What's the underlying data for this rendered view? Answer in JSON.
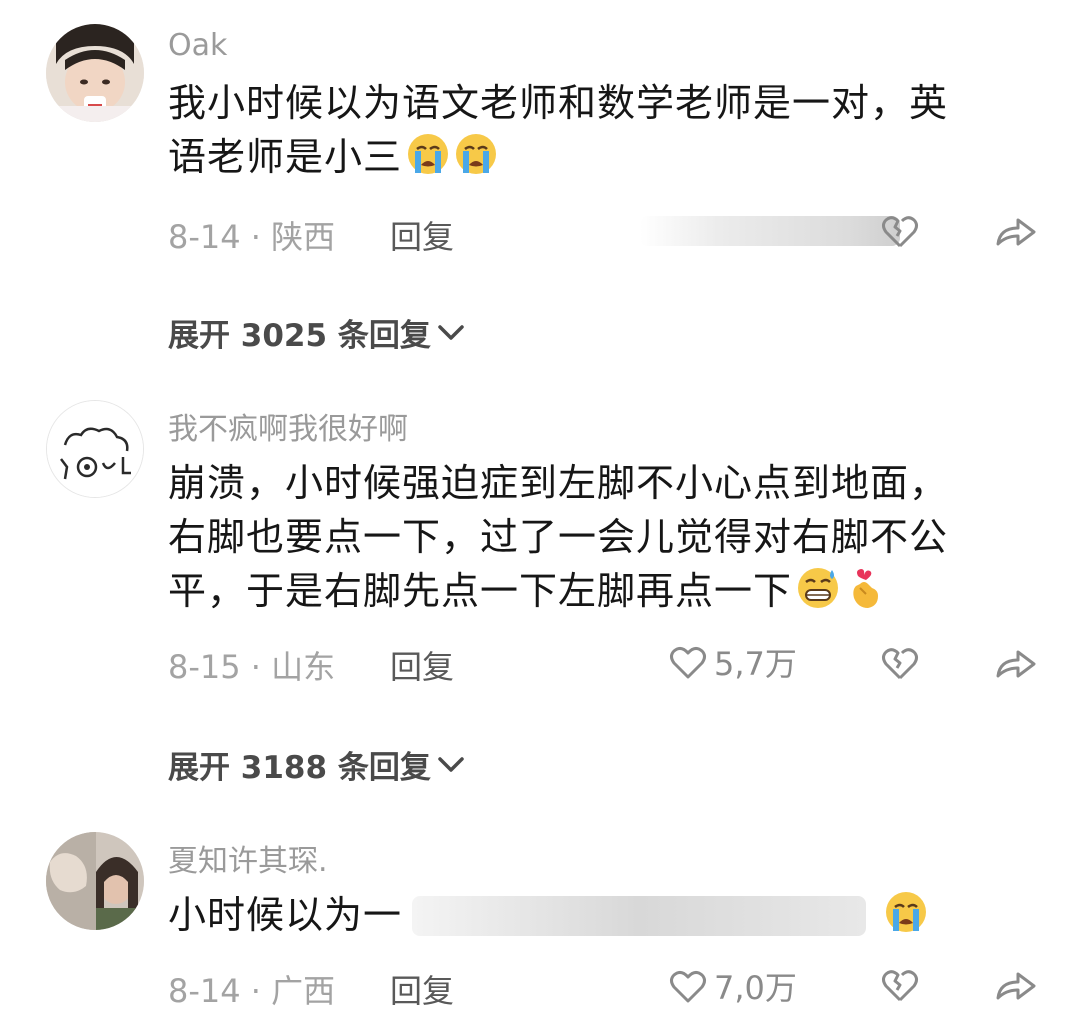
{
  "comments": [
    {
      "username": "Oak",
      "text_line1": "我小时候以为语文老师和数学老师是一对，英",
      "text_line2": "语老师是小三",
      "emojis": [
        "loudly-crying-face",
        "loudly-crying-face"
      ],
      "date_location": "8-14 · 陕西",
      "reply_label": "回复",
      "expand_label": "展开 3025 条回复"
    },
    {
      "username": "我不疯啊我很好啊",
      "text_line1": "崩溃，小时候强迫症到左脚不小心点到地面，",
      "text_line2": "右脚也要点一下，过了一会儿觉得对右脚不公",
      "text_line3": "平，于是右脚先点一下左脚再点一下",
      "emojis": [
        "grinning-face-with-sweat",
        "finger-heart"
      ],
      "date_location": "8-15 · 山东",
      "reply_label": "回复",
      "like_count": "5,7万",
      "expand_label": "展开 3188 条回复"
    },
    {
      "username": "夏知许其琛.",
      "text_line1": "小时候以为一",
      "emojis": [
        "loudly-crying-face"
      ],
      "date_location": "8-14 · 广西",
      "reply_label": "回复",
      "like_count": "7,0万"
    }
  ],
  "colors": {
    "username": "#9a9a9a",
    "meta": "#a3a3a3",
    "reply": "#595959",
    "expand": "#4a4a4a",
    "text": "#161616",
    "emoji_yellow": "#f7c948",
    "emoji_tear": "#4aa8e8"
  }
}
